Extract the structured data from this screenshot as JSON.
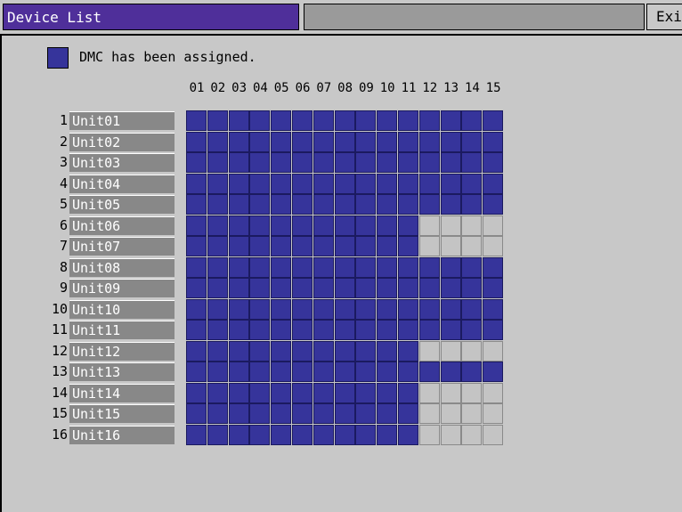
{
  "window": {
    "title": "Device List",
    "exit_label": "Exit"
  },
  "legend": {
    "text": "DMC has been assigned."
  },
  "colors": {
    "assigned": "#36349b",
    "unassigned": "#c4c4c4",
    "title_bg": "#4f2f9a"
  },
  "columns": [
    "01",
    "02",
    "03",
    "04",
    "05",
    "06",
    "07",
    "08",
    "09",
    "10",
    "11",
    "12",
    "13",
    "14",
    "15"
  ],
  "units": [
    {
      "num": "1",
      "name": "Unit01",
      "assigned": [
        1,
        1,
        1,
        1,
        1,
        1,
        1,
        1,
        1,
        1,
        1,
        1,
        1,
        1,
        1
      ]
    },
    {
      "num": "2",
      "name": "Unit02",
      "assigned": [
        1,
        1,
        1,
        1,
        1,
        1,
        1,
        1,
        1,
        1,
        1,
        1,
        1,
        1,
        1
      ]
    },
    {
      "num": "3",
      "name": "Unit03",
      "assigned": [
        1,
        1,
        1,
        1,
        1,
        1,
        1,
        1,
        1,
        1,
        1,
        1,
        1,
        1,
        1
      ]
    },
    {
      "num": "4",
      "name": "Unit04",
      "assigned": [
        1,
        1,
        1,
        1,
        1,
        1,
        1,
        1,
        1,
        1,
        1,
        1,
        1,
        1,
        1
      ]
    },
    {
      "num": "5",
      "name": "Unit05",
      "assigned": [
        1,
        1,
        1,
        1,
        1,
        1,
        1,
        1,
        1,
        1,
        1,
        1,
        1,
        1,
        1
      ]
    },
    {
      "num": "6",
      "name": "Unit06",
      "assigned": [
        1,
        1,
        1,
        1,
        1,
        1,
        1,
        1,
        1,
        1,
        1,
        0,
        0,
        0,
        0
      ]
    },
    {
      "num": "7",
      "name": "Unit07",
      "assigned": [
        1,
        1,
        1,
        1,
        1,
        1,
        1,
        1,
        1,
        1,
        1,
        0,
        0,
        0,
        0
      ]
    },
    {
      "num": "8",
      "name": "Unit08",
      "assigned": [
        1,
        1,
        1,
        1,
        1,
        1,
        1,
        1,
        1,
        1,
        1,
        1,
        1,
        1,
        1
      ]
    },
    {
      "num": "9",
      "name": "Unit09",
      "assigned": [
        1,
        1,
        1,
        1,
        1,
        1,
        1,
        1,
        1,
        1,
        1,
        1,
        1,
        1,
        1
      ]
    },
    {
      "num": "10",
      "name": "Unit10",
      "assigned": [
        1,
        1,
        1,
        1,
        1,
        1,
        1,
        1,
        1,
        1,
        1,
        1,
        1,
        1,
        1
      ]
    },
    {
      "num": "11",
      "name": "Unit11",
      "assigned": [
        1,
        1,
        1,
        1,
        1,
        1,
        1,
        1,
        1,
        1,
        1,
        1,
        1,
        1,
        1
      ]
    },
    {
      "num": "12",
      "name": "Unit12",
      "assigned": [
        1,
        1,
        1,
        1,
        1,
        1,
        1,
        1,
        1,
        1,
        1,
        0,
        0,
        0,
        0
      ]
    },
    {
      "num": "13",
      "name": "Unit13",
      "assigned": [
        1,
        1,
        1,
        1,
        1,
        1,
        1,
        1,
        1,
        1,
        1,
        1,
        1,
        1,
        1
      ]
    },
    {
      "num": "14",
      "name": "Unit14",
      "assigned": [
        1,
        1,
        1,
        1,
        1,
        1,
        1,
        1,
        1,
        1,
        1,
        0,
        0,
        0,
        0
      ]
    },
    {
      "num": "15",
      "name": "Unit15",
      "assigned": [
        1,
        1,
        1,
        1,
        1,
        1,
        1,
        1,
        1,
        1,
        1,
        0,
        0,
        0,
        0
      ]
    },
    {
      "num": "16",
      "name": "Unit16",
      "assigned": [
        1,
        1,
        1,
        1,
        1,
        1,
        1,
        1,
        1,
        1,
        1,
        0,
        0,
        0,
        0
      ]
    }
  ]
}
